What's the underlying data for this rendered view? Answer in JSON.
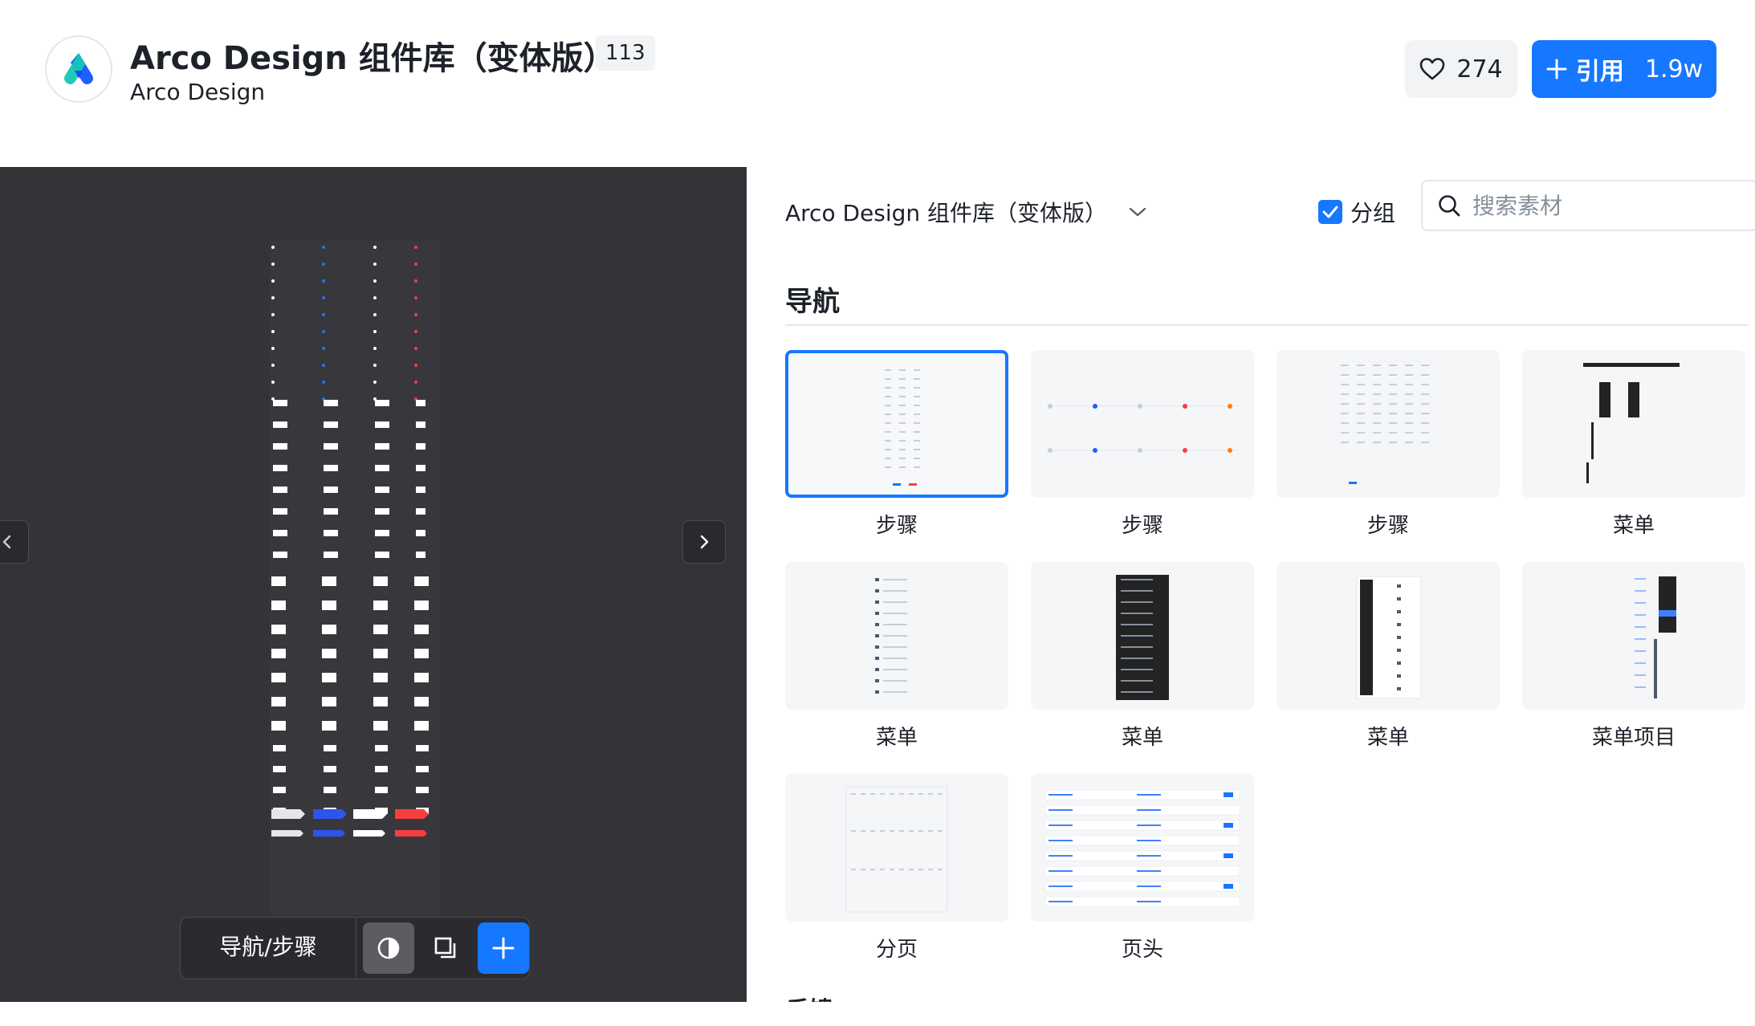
{
  "header": {
    "title": "Arco Design 组件库（变体版）",
    "subtitle": "Arco Design",
    "version": "113",
    "likes": "274",
    "cite_label": "引用",
    "cite_count": "1.9w"
  },
  "preview": {
    "toolbar_label": "导航/步骤"
  },
  "panel": {
    "library_select": "Arco Design 组件库（变体版）",
    "group_label": "分组",
    "group_checked": true,
    "search_placeholder": "搜索素材",
    "section_title": "导航",
    "next_section_title": "反馈",
    "cards": [
      {
        "label": "步骤",
        "selected": true
      },
      {
        "label": "步骤",
        "selected": false
      },
      {
        "label": "步骤",
        "selected": false
      },
      {
        "label": "菜单",
        "selected": false
      },
      {
        "label": "菜单",
        "selected": false
      },
      {
        "label": "菜单",
        "selected": false
      },
      {
        "label": "菜单",
        "selected": false
      },
      {
        "label": "菜单项目",
        "selected": false
      },
      {
        "label": "分页",
        "selected": false
      },
      {
        "label": "页头",
        "selected": false
      }
    ]
  },
  "icons": {
    "logo": "arco-logo-icon",
    "like": "heart-icon",
    "cite": "plus-icon",
    "dropdown": "chevron-down-icon",
    "search": "search-icon",
    "prev": "chevron-left-icon",
    "next": "chevron-right-icon",
    "theme": "contrast-icon",
    "copy": "copy-icon",
    "add": "plus-icon"
  },
  "colors": {
    "primary": "#1677ff",
    "preview_bg": "#343438",
    "thumb_bg": "#f5f6f8"
  }
}
